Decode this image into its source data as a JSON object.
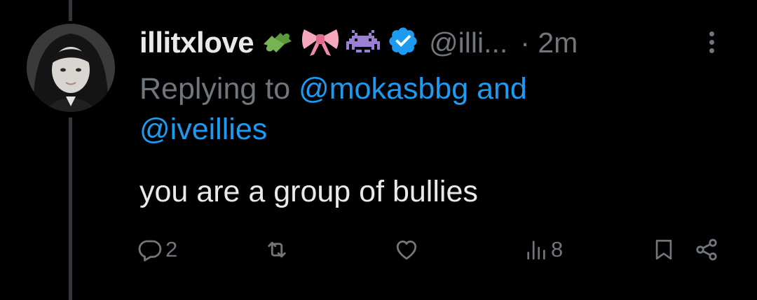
{
  "tweet": {
    "display_name": "illitxlove",
    "emojis": [
      "puzzle-piece-emoji",
      "ribbon-emoji",
      "alien-monster-emoji"
    ],
    "handle": "@illi...",
    "time": "· 2m",
    "reply_prefix": "Replying to ",
    "reply_mention_1": "@mokasbbg",
    "reply_and": " and",
    "reply_mention_2": "@iveillies",
    "text": "you are a group of bullies"
  },
  "actions": {
    "reply_count": "2",
    "retweet_count": "",
    "like_count": "",
    "views_count": "8"
  },
  "colors": {
    "background": "#000000",
    "primary_text": "#e7e9ea",
    "secondary_text": "#71767b",
    "accent": "#1d9bf0",
    "thread_line": "#333639"
  }
}
